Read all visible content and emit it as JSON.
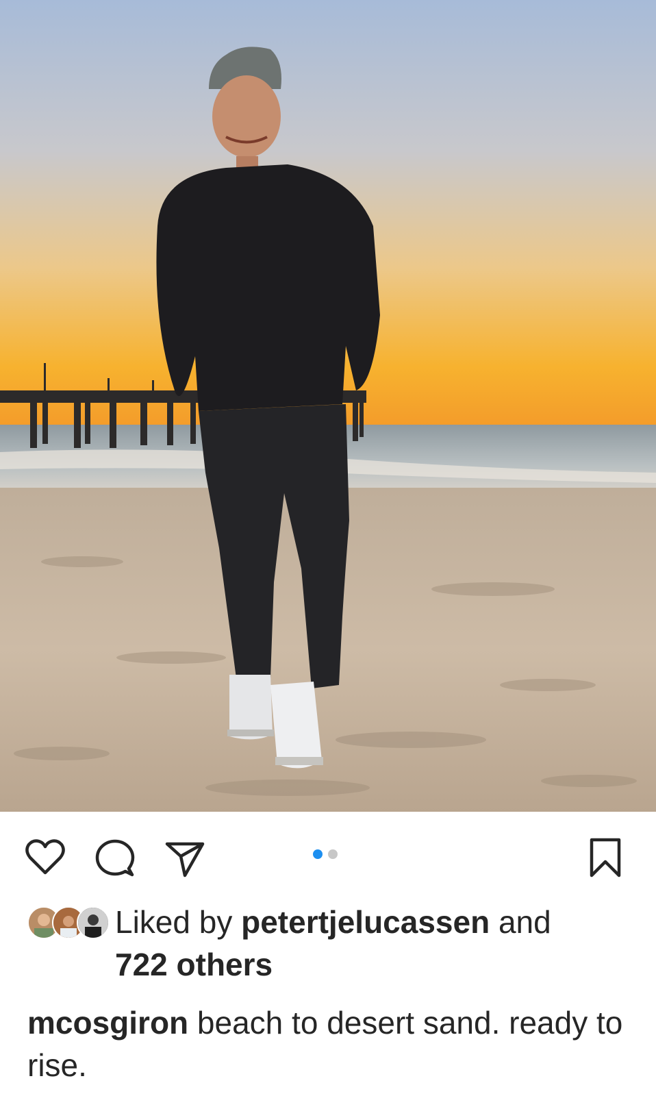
{
  "post": {
    "image": {
      "alt_icon": "photo-beach-sunset-pier",
      "colors": {
        "sky_top": "#a9bcd8",
        "sky_mid": "#d9cfc4",
        "sky_horizon": "#f6b23a",
        "sea": "#9aa6ad",
        "sand": "#c9b7a2"
      }
    },
    "actions": {
      "like_icon": "heart-icon",
      "comment_icon": "comment-icon",
      "share_icon": "paper-plane-icon",
      "save_icon": "bookmark-icon"
    },
    "carousel": {
      "current": 1,
      "total": 2,
      "active_color": "#1d8ff0",
      "inactive_color": "#c7c7c7"
    },
    "likes": {
      "prefix": "Liked by ",
      "user": "petertjelucassen",
      "joiner": " and",
      "others": "722 others"
    },
    "caption": {
      "username": "mcosgiron",
      "text": " beach to desert sand. ready to rise."
    }
  }
}
